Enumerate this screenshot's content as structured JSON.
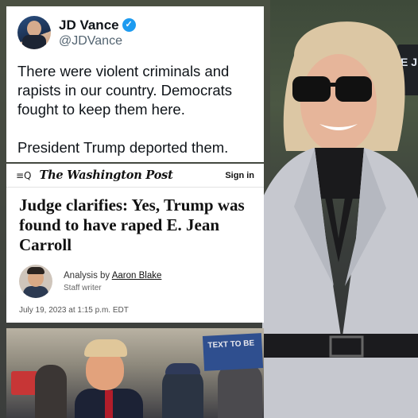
{
  "tweet": {
    "name": "JD Vance",
    "verified_mark": "✓",
    "handle": "@JDVance",
    "paragraphs": [
      "There were violent criminals and rapists in our country. Democrats fought to keep them here.",
      "President Trump deported them."
    ]
  },
  "article": {
    "nav_icon": "≡Q",
    "masthead": "The Washington Post",
    "signin": "Sign in",
    "headline": "Judge clarifies: Yes, Trump was found to have raped E. Jean Carroll",
    "byline_prefix": "Analysis by ",
    "author": "Aaron Blake",
    "role": "Staff writer",
    "date": "July 19, 2023 at 1:15 p.m. EDT"
  },
  "photo": {
    "protest_sign": "TEXT TO BE",
    "right_sign": "E J"
  },
  "colors": {
    "verified": "#1d9bf0",
    "tie": "#b21d2a",
    "protest_sign": "#2f4f8f"
  }
}
